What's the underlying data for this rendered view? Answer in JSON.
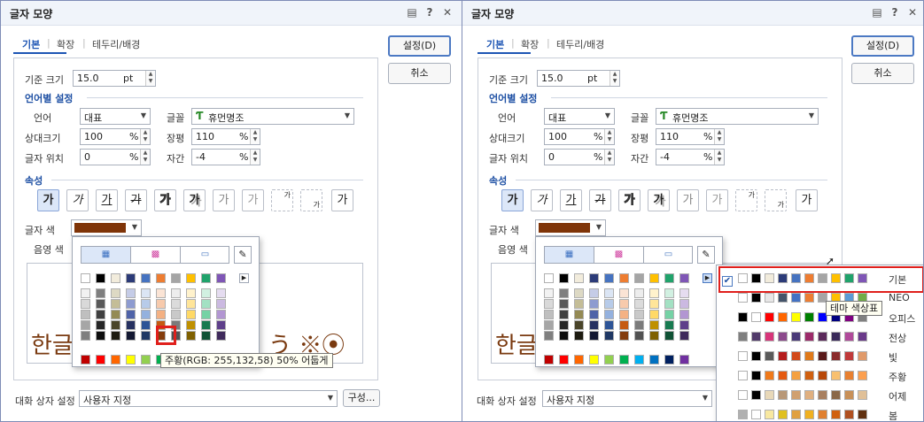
{
  "left": {
    "title": "글자 모양",
    "tabs": [
      "기본",
      "확장",
      "테두리/배경"
    ],
    "base_size_label": "기준 크기",
    "base_size_value": "15.0",
    "base_size_unit": "pt",
    "lang_header": "언어별 설정",
    "lang_label": "언어",
    "lang_value": "대표",
    "font_label": "글꼴",
    "font_value": "휴먼명조",
    "rel_size_label": "상대크기",
    "rel_size_value": "100",
    "rel_unit": "%",
    "ratio_label": "장평",
    "ratio_value": "110",
    "pos_label": "글자 위치",
    "pos_value": "0",
    "spacing_label": "자간",
    "spacing_value": "-4",
    "attr_header": "속성",
    "ga_label": "가",
    "color_label": "글자 색",
    "shade_label": "음영 색",
    "preview_text_start": "한글",
    "preview_text_end": "う ※⦿",
    "dialog_settings_label": "대화 상자 설정",
    "dialog_settings_value": "사용자 지정",
    "compose_label": "구성...",
    "ok_label": "설정(D)",
    "cancel_label": "취소",
    "tooltip": "주황(RGB: 255,132,58) 50% 어둡게"
  },
  "right": {
    "title": "글자 모양",
    "tabs": [
      "기본",
      "확장",
      "테두리/배경"
    ],
    "base_size_label": "기준 크기",
    "base_size_value": "15.0",
    "base_size_unit": "pt",
    "lang_header": "언어별 설정",
    "lang_label": "언어",
    "lang_value": "대표",
    "font_label": "글꼴",
    "font_value": "휴먼명조",
    "rel_size_label": "상대크기",
    "rel_size_value": "100",
    "rel_unit": "%",
    "ratio_label": "장평",
    "ratio_value": "110",
    "pos_label": "글자 위치",
    "pos_value": "0",
    "spacing_label": "자간",
    "spacing_value": "-4",
    "attr_header": "속성",
    "ga_label": "가",
    "color_label": "글자 색",
    "shade_label": "음영 색",
    "preview_text_start": "한글",
    "dialog_settings_label": "대화 상자 설정",
    "dialog_settings_value": "사용자 지정",
    "ok_label": "설정(D)",
    "cancel_label": "취소",
    "tooltip": "테마 색상표",
    "themes": [
      "기본",
      "NEO",
      "오피스",
      "전상",
      "빛",
      "주황",
      "어제",
      "봄"
    ]
  },
  "colors": {
    "text_color_swatch": "#7f3408",
    "accent": "#1d55b4",
    "highlight_red": "#e0201c",
    "preview_text": "#7a3a10",
    "top_row": [
      "#ffffff",
      "#000000",
      "#f2ecdc",
      "#2c3b78",
      "#4673c0",
      "#ee7d31",
      "#a5a5a5",
      "#ffc000",
      "#20a36b",
      "#7f56b6"
    ],
    "shade_cols": [
      [
        "#f2f2f2",
        "#d9d9d9",
        "#bfbfbf",
        "#a6a6a6",
        "#7f7f7f"
      ],
      [
        "#7f7f7f",
        "#595959",
        "#404040",
        "#262626",
        "#0d0d0d"
      ],
      [
        "#ddd9c4",
        "#c4bd97",
        "#948a54",
        "#4a452a",
        "#1d1b10"
      ],
      [
        "#c5cce7",
        "#8d9bd0",
        "#4f63a8",
        "#263160",
        "#131832"
      ],
      [
        "#dbe5f4",
        "#b7cbe9",
        "#94b1de",
        "#2e5597",
        "#1f3864"
      ],
      [
        "#fbe4d5",
        "#f7caac",
        "#f4b183",
        "#c55a11",
        "#843c0c"
      ],
      [
        "#ededed",
        "#dbdbdb",
        "#c9c9c9",
        "#7b7b7b",
        "#525252"
      ],
      [
        "#fff2cc",
        "#ffe599",
        "#ffd966",
        "#bf9000",
        "#7f6000"
      ],
      [
        "#d1f0e1",
        "#a3e1c3",
        "#75d2a5",
        "#187a50",
        "#105235"
      ],
      [
        "#e5dcf0",
        "#cbb9e1",
        "#b296d2",
        "#5e3f8a",
        "#3f2a5c"
      ]
    ],
    "standard_row": [
      "#c00000",
      "#ff0000",
      "#ff6600",
      "#ffff00",
      "#92d050",
      "#00b050",
      "#00b0f0",
      "#0070c0",
      "#002060",
      "#7030a0"
    ],
    "theme_rows": [
      [
        "#ffffff",
        "#000000",
        "#f2ecdc",
        "#2c3b78",
        "#4673c0",
        "#ee7d31",
        "#a5a5a5",
        "#ffc000",
        "#20a36b",
        "#7f56b6"
      ],
      [
        "#ffffff",
        "#000000",
        "#e7e6e6",
        "#44546a",
        "#4472c4",
        "#ed7d31",
        "#a5a5a5",
        "#ffc000",
        "#5b9bd5",
        "#70ad47"
      ],
      [
        "#000000",
        "#ffffff",
        "#ff0000",
        "#ff6600",
        "#ffff00",
        "#008000",
        "#0000ff",
        "#000080",
        "#800080",
        "#808080"
      ],
      [
        "#7f7f7f",
        "#513a6a",
        "#d8357a",
        "#8c4a8c",
        "#4a3a78",
        "#9c2a6a",
        "#5c2a5c",
        "#3a2a5a",
        "#b04a9a",
        "#6a3a8a"
      ],
      [
        "#ffffff",
        "#000000",
        "#5a5a5a",
        "#b51d1d",
        "#d24a1a",
        "#e07a1a",
        "#5a1a1a",
        "#8a2a2a",
        "#c03a3a",
        "#e09a6a"
      ],
      [
        "#ffffff",
        "#000000",
        "#f07a1a",
        "#e55a10",
        "#f4a040",
        "#d06010",
        "#b84808",
        "#f8c070",
        "#e88030",
        "#fca050"
      ],
      [
        "#ffffff",
        "#000000",
        "#e8d8b8",
        "#b89878",
        "#d0a070",
        "#e0b080",
        "#a88060",
        "#8a6848",
        "#c89058",
        "#e0c098"
      ],
      [
        "#b0b0b0",
        "#ffffff",
        "#f8e8a0",
        "#e0c020",
        "#e0a040",
        "#f0b020",
        "#e08030",
        "#d06010",
        "#b05020",
        "#603010"
      ]
    ]
  }
}
